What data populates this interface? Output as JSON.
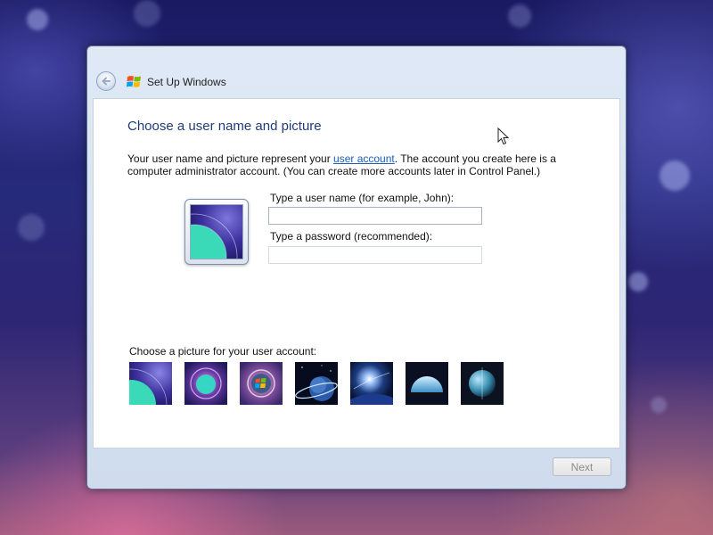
{
  "window": {
    "title": "Set Up Windows"
  },
  "main": {
    "heading": "Choose a user name and picture",
    "description_before_link": "Your user name and picture represent your ",
    "description_link": "user account",
    "description_after_link": ". The account you create here is a computer administrator account. (You can create more accounts later in Control Panel.)",
    "username_label": "Type a user name (for example, John):",
    "username_value": "",
    "password_label": "Type a password (recommended):",
    "password_value": "",
    "picture_label": "Choose a picture for your user account:",
    "selected_picture_index": 0,
    "pictures": [
      {
        "icon": "planet-arc-picture"
      },
      {
        "icon": "planet-glow-picture"
      },
      {
        "icon": "windows-orb-picture"
      },
      {
        "icon": "planet-ring-picture"
      },
      {
        "icon": "space-burst-picture"
      },
      {
        "icon": "planet-dome-picture"
      },
      {
        "icon": "earth-globe-picture"
      }
    ]
  },
  "footer": {
    "next_label": "Next"
  },
  "colors": {
    "heading": "#1e3d78",
    "link": "#1a5db5",
    "accent_teal": "#39d8b8"
  }
}
